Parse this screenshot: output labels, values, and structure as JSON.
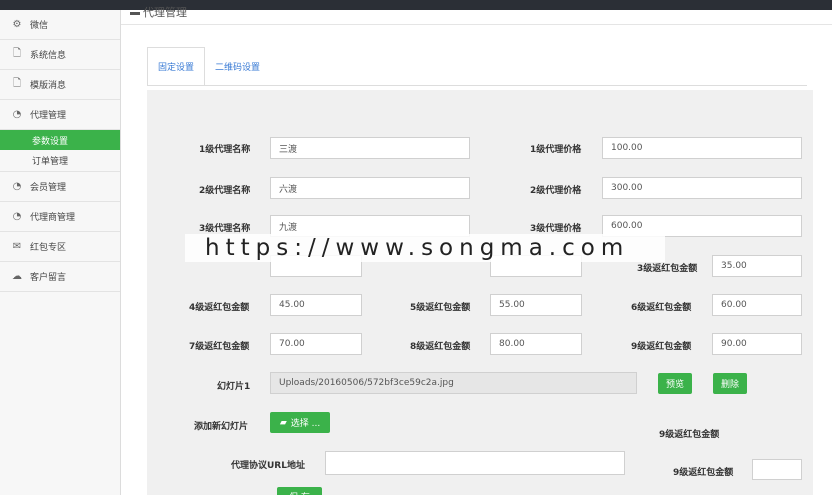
{
  "header": {
    "title": "代理管理"
  },
  "sidebar": {
    "items": [
      {
        "label": "微信",
        "icon": "gear-icon"
      },
      {
        "label": "系统信息",
        "icon": "file-icon"
      },
      {
        "label": "模版消息",
        "icon": "file-icon"
      },
      {
        "label": "代理管理",
        "icon": "rss-icon"
      },
      {
        "label": "会员管理",
        "icon": "rss-icon"
      },
      {
        "label": "代理商管理",
        "icon": "rss-icon"
      },
      {
        "label": "红包专区",
        "icon": "envelope-icon"
      },
      {
        "label": "客户留言",
        "icon": "chat-icon"
      }
    ],
    "sub_items": [
      {
        "label": "参数设置",
        "active": true
      },
      {
        "label": "订单管理",
        "active": false
      }
    ]
  },
  "tabs": [
    {
      "label": "固定设置",
      "active": true
    },
    {
      "label": "二维码设置",
      "active": false
    }
  ],
  "form": {
    "agent_name_1": {
      "label": "1级代理名称",
      "value": "三渡"
    },
    "agent_name_2": {
      "label": "2级代理名称",
      "value": "六渡"
    },
    "agent_name_3": {
      "label": "3级代理名称",
      "value": "九渡"
    },
    "agent_price_1": {
      "label": "1级代理价格",
      "value": "100.00"
    },
    "agent_price_2": {
      "label": "2级代理价格",
      "value": "300.00"
    },
    "agent_price_3": {
      "label": "3级代理价格",
      "value": "600.00"
    },
    "bonus_3": {
      "label": "3级返红包金额",
      "value": "35.00"
    },
    "bonus_4": {
      "label": "4级返红包金额",
      "value": "45.00"
    },
    "bonus_5": {
      "label": "5级返红包金额",
      "value": "55.00"
    },
    "bonus_6": {
      "label": "6级返红包金额",
      "value": "60.00"
    },
    "bonus_7": {
      "label": "7级返红包金额",
      "value": "70.00"
    },
    "bonus_8": {
      "label": "8级返红包金额",
      "value": "80.00"
    },
    "bonus_9": {
      "label": "9级返红包金额",
      "value": "90.00"
    },
    "slide": {
      "label": "幻灯片1",
      "value": "Uploads/20160506/572bf3ce59c2a.jpg",
      "preview_label": "预览",
      "delete_label": "删除"
    },
    "add_slide": {
      "label": "添加新幻灯片",
      "select_label": "选择 ..."
    },
    "agreement_url": {
      "label": "代理协议URL地址",
      "value": ""
    },
    "floating_label_a": "9级返红包金额",
    "floating_label_b": "9级返红包金额",
    "save_label": "保 存"
  },
  "watermark": "https://www.songma.com",
  "colors": {
    "accent": "#3bb24a",
    "tab_text": "#3a7bd5",
    "panel": "#f0f0f0"
  }
}
